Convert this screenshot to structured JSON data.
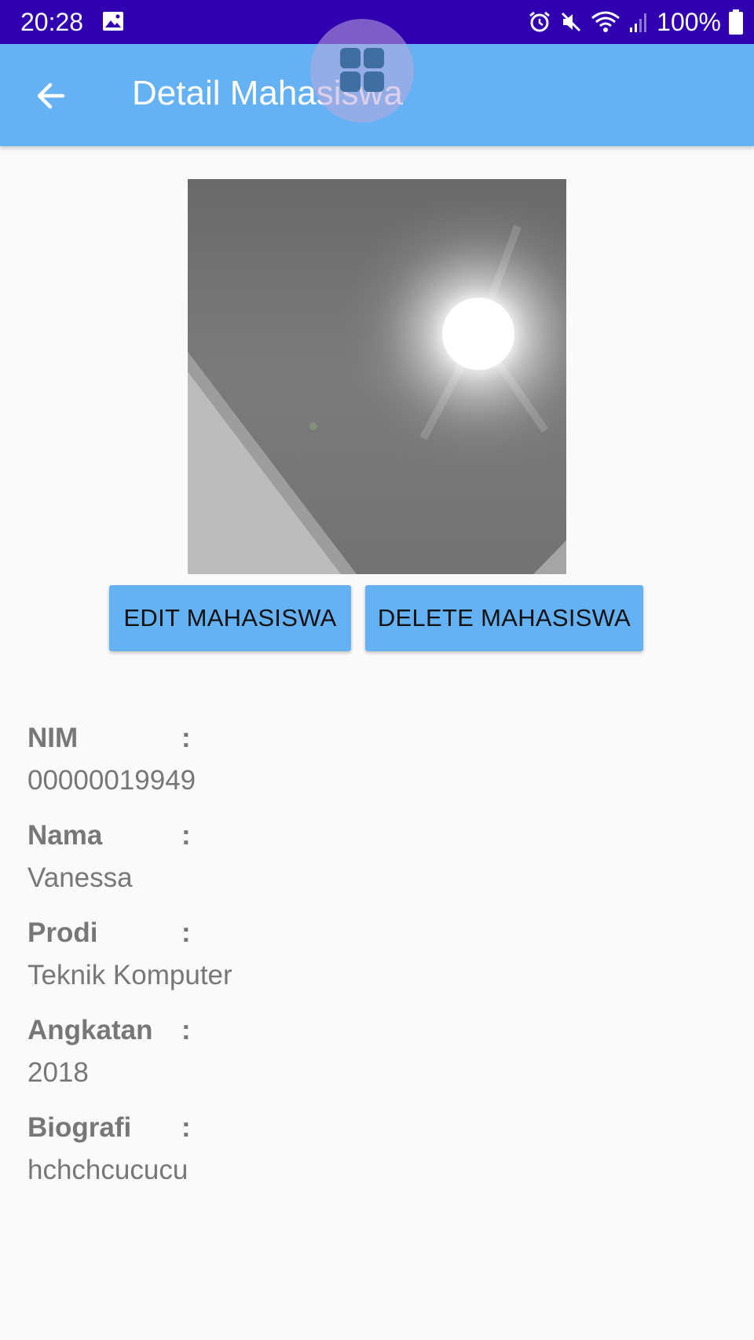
{
  "status_bar": {
    "time": "20:28",
    "battery": "100%",
    "icons": [
      "gallery-icon",
      "alarm-icon",
      "mute-icon",
      "wifi-icon",
      "signal-icon",
      "battery-icon"
    ]
  },
  "app_bar": {
    "title": "Detail Mahasiswa",
    "back_icon": "arrow-back-icon"
  },
  "overlay": {
    "icon": "grid-apps-icon"
  },
  "actions": {
    "edit_label": "EDIT MAHASISWA",
    "delete_label": "DELETE MAHASISWA"
  },
  "details": {
    "separator": ":",
    "fields": [
      {
        "label": "NIM",
        "value": "00000019949"
      },
      {
        "label": "Nama",
        "value": "Vanessa"
      },
      {
        "label": "Prodi",
        "value": "Teknik Komputer"
      },
      {
        "label": "Angkatan",
        "value": "2018"
      },
      {
        "label": "Biografi",
        "value": "hchchcucucu"
      }
    ]
  },
  "colors": {
    "status_bar": "#3000b0",
    "app_bar": "#64b1f4",
    "button": "#64b1f4",
    "text_muted": "#777777",
    "background": "#fafafa"
  }
}
